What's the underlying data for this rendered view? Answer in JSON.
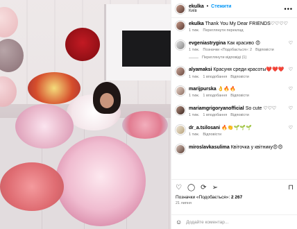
{
  "header": {
    "username": "ekulka",
    "dot": "•",
    "follow_label": "Стежити",
    "location": "Київ"
  },
  "caption": {
    "username": "ekulka",
    "text": "Thank You My Dear FRIENDS♡♡♡♡",
    "time": "1 тиж.",
    "translation": "Переглянути переклад"
  },
  "comments": [
    {
      "username": "evgeniastrygina",
      "text": "Как красиво 😍",
      "time": "1 тиж.",
      "likes": "",
      "reply": "Відповісти",
      "view_replies": "Переглянути відповіді (1)"
    },
    {
      "username": "alyamaksi",
      "text": "Красуня среди красоты❤️❤️❤️",
      "time": "1 тиж.",
      "likes": "1 вподобання",
      "reply": "Відповісти",
      "view_replies": ""
    },
    {
      "username": "marijpurska",
      "text": "👌🔥🔥",
      "time": "1 тиж.",
      "likes": "1 вподобання",
      "reply": "Відповісти",
      "view_replies": ""
    },
    {
      "username": "mariamgrigoryanofficial",
      "text": "So cute ♡♡♡",
      "time": "1 тиж.",
      "likes": "1 вподобання",
      "reply": "Відповісти",
      "view_replies": ""
    },
    {
      "username": "dr_a.tsilosani",
      "text": "🔥👏🌱🌱🌱",
      "time": "1 тиж.",
      "likes": "",
      "reply": "Відповісти",
      "view_replies": ""
    },
    {
      "username": "miroslavkasulima",
      "text": "Квіточка у квітнику😍😍",
      "time": "",
      "likes": "",
      "reply": "",
      "view_replies": ""
    }
  ],
  "footer": {
    "likes_prefix": "Позначки «Подобається»:",
    "likes_count": "2 267",
    "date": "21 липня",
    "add_comment_placeholder": "Додайте коментар..."
  },
  "icons": [
    "more-icon",
    "heart-icon",
    "comment-icon",
    "share-icon",
    "save-icon",
    "emoji-icon"
  ]
}
